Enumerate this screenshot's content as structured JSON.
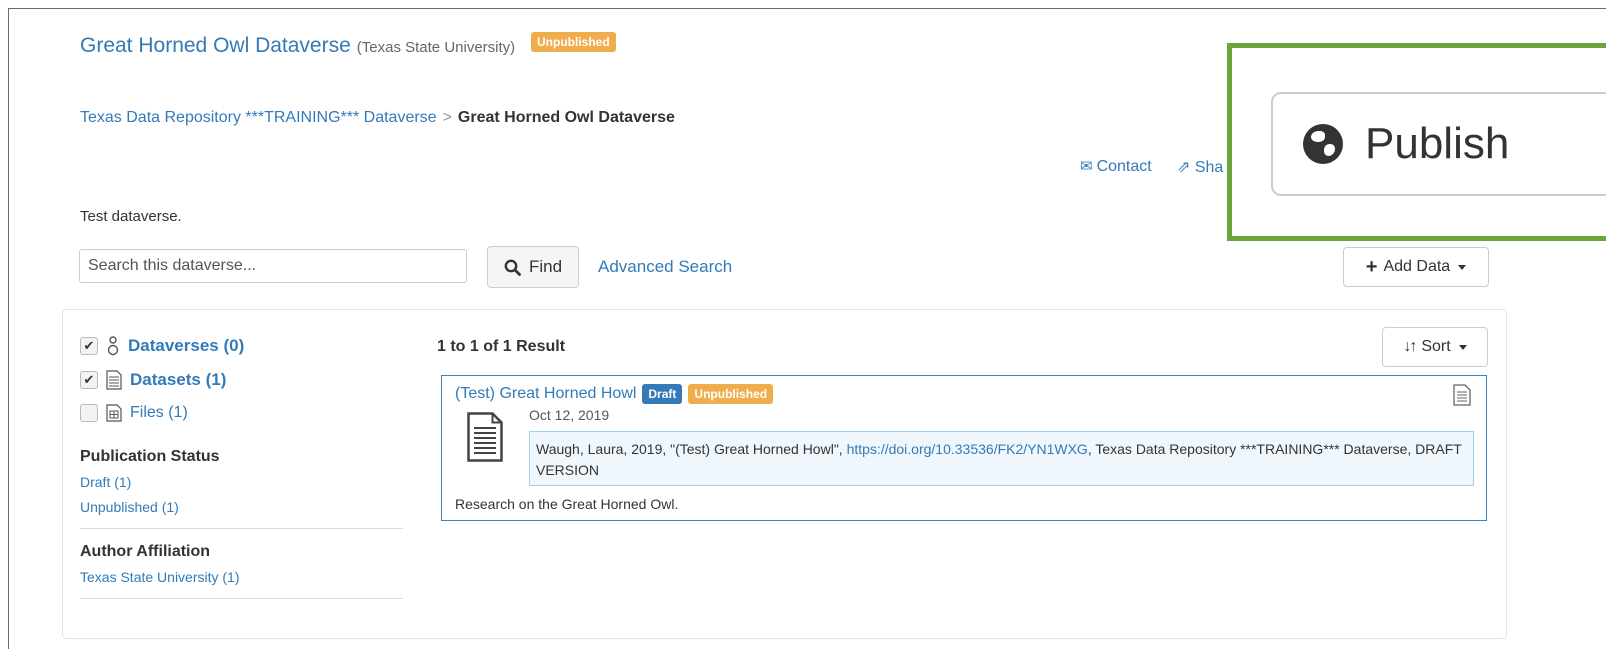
{
  "header": {
    "dataverse_name": "Great Horned Owl Dataverse",
    "affiliation": "(Texas State University)",
    "status_badge": "Unpublished"
  },
  "breadcrumb": {
    "parent": "Texas Data Repository ***TRAINING*** Dataverse",
    "separator": ">",
    "current": "Great Horned Owl Dataverse"
  },
  "actions": {
    "contact_label": "Contact",
    "share_label": "Sha",
    "publish_label": "Publish",
    "add_data_label": "Add Data"
  },
  "description": "Test dataverse.",
  "search": {
    "placeholder": "Search this dataverse...",
    "find_label": "Find",
    "advanced_label": "Advanced Search"
  },
  "facets": {
    "types": [
      {
        "label": "Dataverses (0)",
        "checked": true,
        "icon": "dataverse-icon"
      },
      {
        "label": "Datasets (1)",
        "checked": true,
        "icon": "dataset-icon"
      },
      {
        "label": "Files (1)",
        "checked": false,
        "icon": "file-icon"
      }
    ],
    "publication_status": {
      "heading": "Publication Status",
      "items": [
        "Draft (1)",
        "Unpublished (1)"
      ]
    },
    "author_affiliation": {
      "heading": "Author Affiliation",
      "items": [
        "Texas State University (1)"
      ]
    }
  },
  "results": {
    "count_text": "1 to 1 of 1 Result",
    "sort_label": "Sort",
    "items": [
      {
        "title": "(Test) Great Horned Howl",
        "badges": [
          "Draft",
          "Unpublished"
        ],
        "date": "Oct 12, 2019",
        "citation_pre": "Waugh, Laura, 2019, \"(Test) Great Horned Howl\", ",
        "citation_doi": "https://doi.org/10.33536/FK2/YN1WXG",
        "citation_post": ", Texas Data Repository ***TRAINING*** Dataverse, DRAFT VERSION",
        "description": "Research on the Great Horned Owl."
      }
    ]
  },
  "colors": {
    "link": "#337ab7",
    "unpublished": "#f0ad4e",
    "draft": "#337ab7",
    "highlight_border": "#6ba43a"
  }
}
